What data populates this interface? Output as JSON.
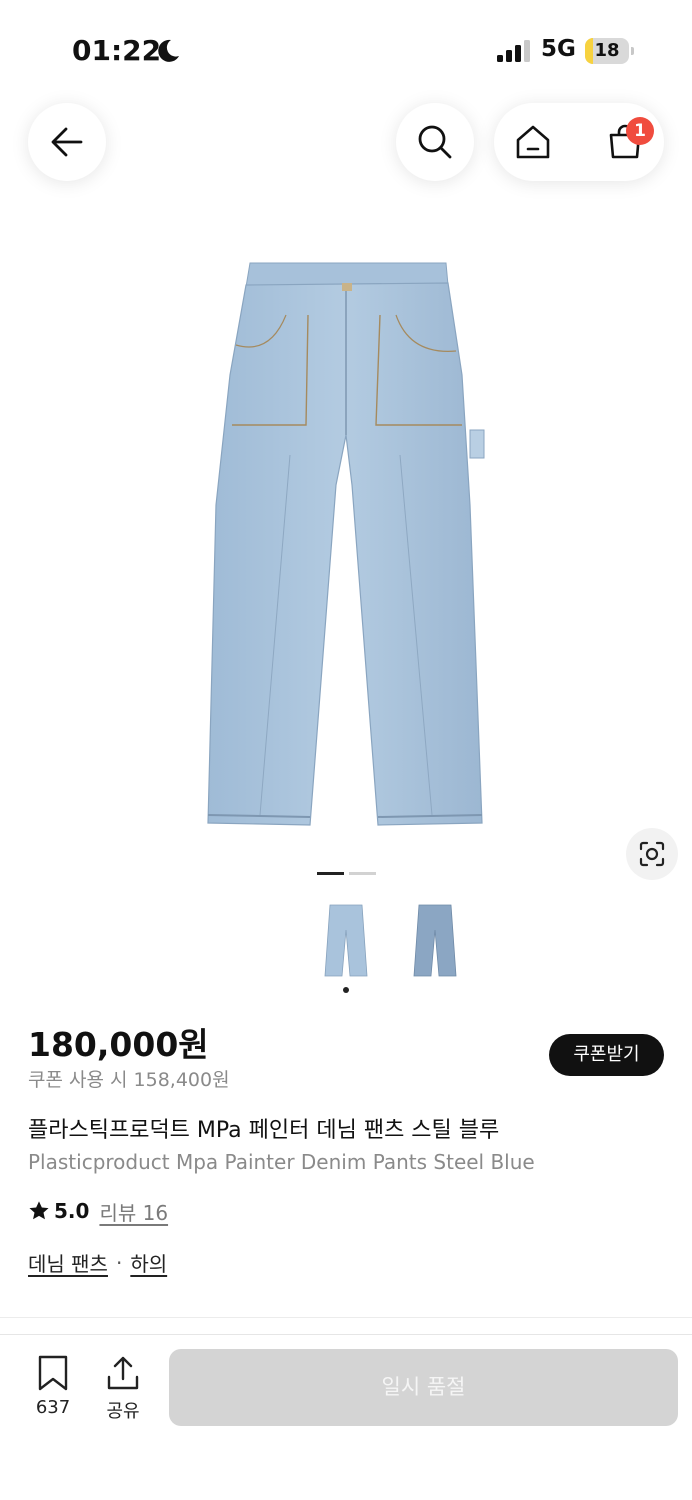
{
  "status_bar": {
    "time": "01:22",
    "network": "5G",
    "battery": "18",
    "battery_level": 0.18
  },
  "nav": {
    "icons": [
      "back-arrow-icon",
      "search-icon",
      "home-icon",
      "shopping-bag-icon"
    ],
    "cart_count": "1"
  },
  "gallery": {
    "image_count": 2,
    "active_index": 0
  },
  "product": {
    "price": "180,000원",
    "coupon_price": "쿠폰 사용 시 158,400원",
    "coupon_button": "쿠폰받기",
    "title_ko": "플라스틱프로덕트 MPa 페인터 데님 팬츠 스틸 블루",
    "title_en": "Plasticproduct Mpa Painter Denim Pants Steel Blue",
    "rating": "5.0",
    "review_link": "리뷰 16",
    "category_1": "데님 팬츠",
    "category_separator": "·",
    "category_2": "하의"
  },
  "bottom_bar": {
    "bookmark_count": "637",
    "share_label": "공유",
    "soldout_label": "일시 품절"
  },
  "colors": {
    "badge": "#f04c3e",
    "battery_fill": "#f7d23f",
    "denim": "#a9c3dc",
    "soldout_bg": "#d4d4d4"
  }
}
